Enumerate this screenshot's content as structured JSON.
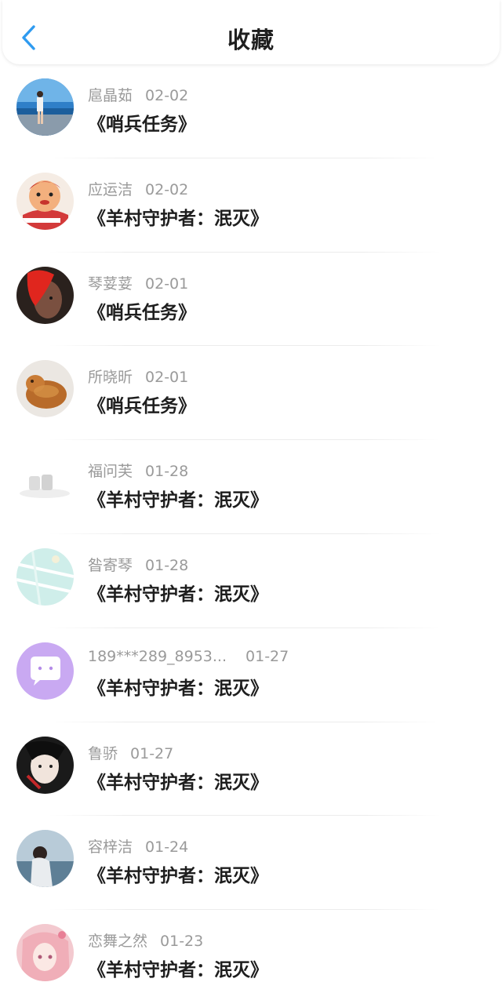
{
  "header": {
    "title": "收藏",
    "back_icon": "chevron-left-icon",
    "accent_color": "#2f9bf0"
  },
  "favorites": [
    {
      "user": "扈晶茹",
      "date": "02-02",
      "title": "《哨兵任务》"
    },
    {
      "user": "应运洁",
      "date": "02-02",
      "title": "《羊村守护者：泯灭》"
    },
    {
      "user": "琴荽荽",
      "date": "02-01",
      "title": "《哨兵任务》"
    },
    {
      "user": "所晓昕",
      "date": "02-01",
      "title": "《哨兵任务》"
    },
    {
      "user": "福问芙",
      "date": "01-28",
      "title": "《羊村守护者：泯灭》"
    },
    {
      "user": "昝寄琴",
      "date": "01-28",
      "title": "《羊村守护者：泯灭》"
    },
    {
      "user": "189***289_8953...",
      "date": "01-27",
      "title": "《羊村守护者：泯灭》"
    },
    {
      "user": "鲁骄",
      "date": "01-27",
      "title": "《羊村守护者：泯灭》"
    },
    {
      "user": "容梓洁",
      "date": "01-24",
      "title": "《羊村守护者：泯灭》"
    },
    {
      "user": "恋舞之然",
      "date": "01-23",
      "title": "《羊村守护者：泯灭》"
    }
  ]
}
